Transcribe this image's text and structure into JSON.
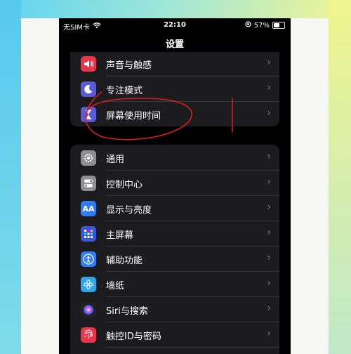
{
  "status": {
    "carrier": "无SIM卡",
    "time": "22:10",
    "battery": "57%"
  },
  "header": {
    "title": "设置"
  },
  "group1": [
    {
      "label": "声音与触感",
      "icon": "speaker-icon",
      "color": "#e8344d"
    },
    {
      "label": "专注模式",
      "icon": "moon-icon",
      "color": "#5b5bd6"
    },
    {
      "label": "屏幕使用时间",
      "icon": "hourglass-icon",
      "color": "#5b5bd6"
    }
  ],
  "group2": [
    {
      "label": "通用",
      "icon": "gear-icon",
      "color": "#8e8e93"
    },
    {
      "label": "控制中心",
      "icon": "toggle-icon",
      "color": "#8e8e93"
    },
    {
      "label": "显示与亮度",
      "icon": "aa-icon",
      "color": "#2f7df6"
    },
    {
      "label": "主屏幕",
      "icon": "grid-icon",
      "color": "#3a55d8"
    },
    {
      "label": "辅助功能",
      "icon": "accessibility-icon",
      "color": "#2f7df6"
    },
    {
      "label": "墙纸",
      "icon": "flower-icon",
      "color": "#30a6e8"
    },
    {
      "label": "Siri与搜索",
      "icon": "siri-icon",
      "color": "#222222"
    },
    {
      "label": "触控ID与密码",
      "icon": "fingerprint-icon",
      "color": "#e8344d"
    }
  ]
}
